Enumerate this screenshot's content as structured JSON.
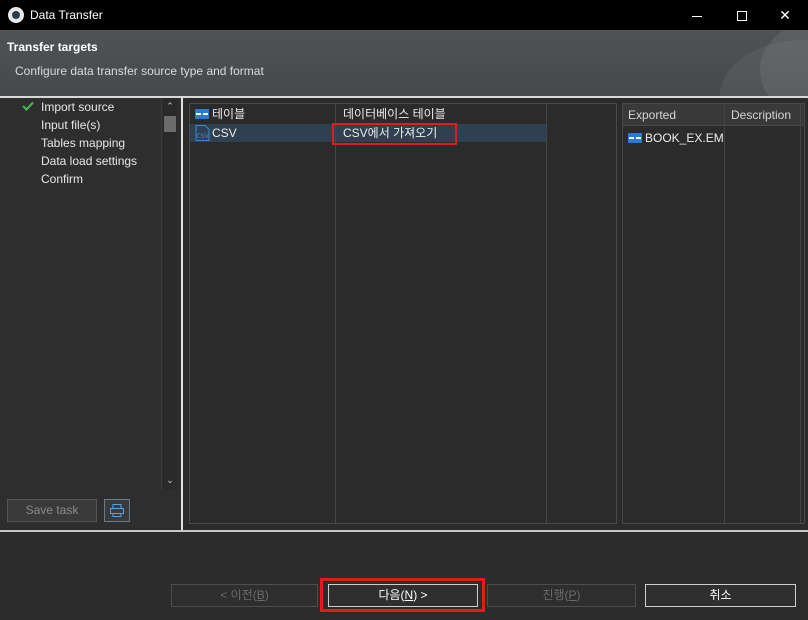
{
  "window": {
    "title": "Data Transfer"
  },
  "header": {
    "title": "Transfer targets",
    "description": "Configure data transfer source type and format"
  },
  "nav": {
    "items": [
      {
        "label": "Import source",
        "done": true
      },
      {
        "label": "Input file(s)",
        "done": false
      },
      {
        "label": "Tables mapping",
        "done": false
      },
      {
        "label": "Data load settings",
        "done": false
      },
      {
        "label": "Confirm",
        "done": false
      }
    ]
  },
  "left_buttons": {
    "save_task": "Save task"
  },
  "source_table": {
    "rows": [
      {
        "name": "테이블",
        "description": "데이터베이스 테이블",
        "icon": "table-icon",
        "selected": false
      },
      {
        "name": "CSV",
        "description": "CSV에서 가져오기",
        "icon": "csv-file-icon",
        "selected": true
      }
    ]
  },
  "export_table": {
    "columns": [
      "Exported",
      "Description"
    ],
    "rows": [
      {
        "name": "BOOK_EX.EMP",
        "icon": "table-icon"
      }
    ]
  },
  "footer": {
    "back_prefix": "< 이전(",
    "back_key": "B",
    "back_suffix": ")",
    "next_prefix": "다음(",
    "next_key": "N",
    "next_suffix": ") >",
    "proceed_prefix": "진행(",
    "proceed_key": "P",
    "proceed_suffix": ")",
    "cancel": "취소"
  },
  "colors": {
    "highlight": "#e21b1b",
    "selection": "#2f4050",
    "check": "#4caf50"
  }
}
